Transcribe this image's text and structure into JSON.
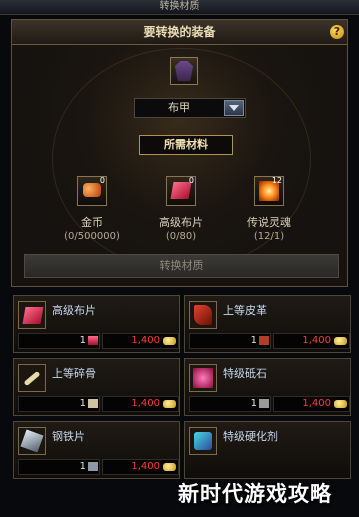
{
  "window": {
    "title": "转换材质"
  },
  "upper": {
    "header": "要转换的装备",
    "help": "?",
    "dropdown": {
      "selected": "布甲"
    },
    "materials_header": "所需材料",
    "materials": [
      {
        "name": "金币",
        "qty": "(0/500000)",
        "count": "0",
        "icon": "coins-icon"
      },
      {
        "name": "高级布片",
        "qty": "(0/80)",
        "count": "0",
        "icon": "cloth-icon"
      },
      {
        "name": "传说灵魂",
        "qty": "(12/1)",
        "count": "12",
        "icon": "soul-icon"
      }
    ],
    "convert_button": "转换材质"
  },
  "items": [
    {
      "name": "高级布片",
      "owned": "1",
      "price": "1,400",
      "icon": "cloth-icon"
    },
    {
      "name": "上等皮革",
      "owned": "1",
      "price": "1,400",
      "icon": "leather-icon"
    },
    {
      "name": "上等碎骨",
      "owned": "1",
      "price": "1,400",
      "icon": "bone-icon"
    },
    {
      "name": "特级砥石",
      "owned": "1",
      "price": "1,400",
      "icon": "whetstone-icon"
    },
    {
      "name": "钢铁片",
      "owned": "1",
      "price": "1,400",
      "icon": "steel-icon"
    },
    {
      "name": "特级硬化剂",
      "owned": "",
      "price": "",
      "icon": "hardener-icon"
    }
  ],
  "watermark": "新时代游戏攻略",
  "colors": {
    "price": "#ff3b2b",
    "gold": "#c9930f",
    "frame": "#5d5240"
  }
}
